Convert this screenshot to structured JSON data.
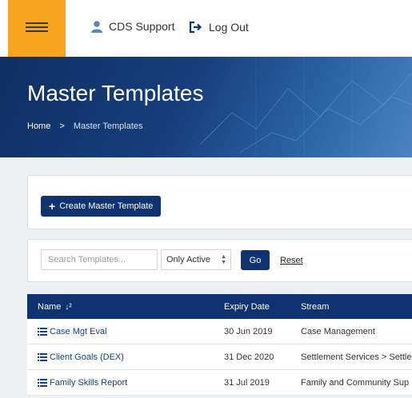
{
  "header": {
    "user_label": "CDS Support",
    "logout_label": "Log Out",
    "menu_color": "#f7a51f"
  },
  "hero": {
    "title": "Master Templates",
    "breadcrumb": {
      "home": "Home",
      "separator": ">",
      "current": "Master Templates"
    }
  },
  "actions": {
    "create_label": "Create Master Template"
  },
  "filters": {
    "search_placeholder": "Search Templates...",
    "status_selected": "Only Active",
    "go_label": "Go",
    "reset_label": "Reset"
  },
  "table": {
    "columns": [
      "Name",
      "Expiry Date",
      "Stream"
    ],
    "rows": [
      {
        "name": "Case Mgt Eval",
        "expiry": "30 Jun 2019",
        "stream": "Case Management"
      },
      {
        "name": "Client Goals (DEX)",
        "expiry": "31 Dec 2020",
        "stream": "Settlement Services > Settle"
      },
      {
        "name": "Family Skills Report",
        "expiry": "31 Jul 2019",
        "stream": "Family and Community Sup"
      }
    ]
  }
}
